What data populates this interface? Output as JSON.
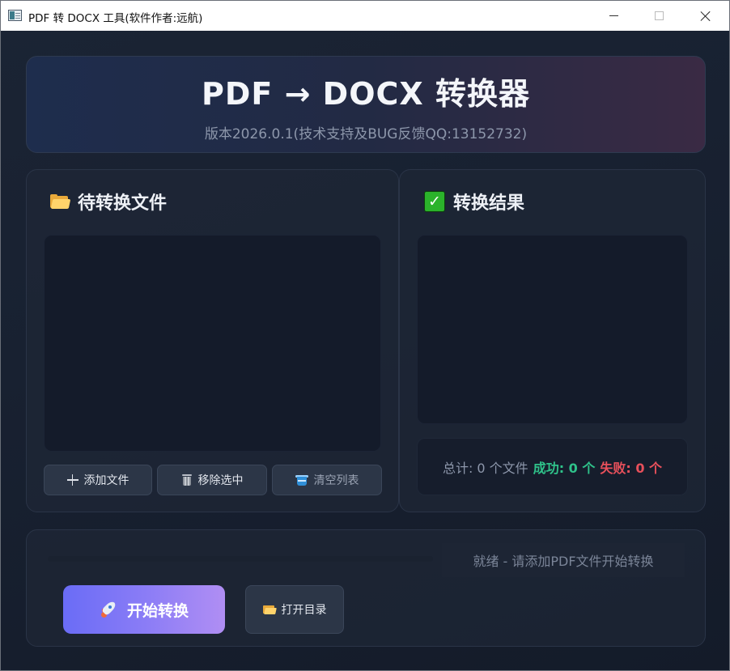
{
  "window": {
    "title": "PDF 转 DOCX 工具(软件作者:远航)"
  },
  "header": {
    "title": "PDF → DOCX 转换器",
    "version": "版本2026.0.1(技术支持及BUG反馈QQ:13152732)"
  },
  "pending_panel": {
    "heading": "待转换文件",
    "icon": "folder-icon",
    "files": [],
    "buttons": {
      "add": "添加文件",
      "remove": "移除选中",
      "clear": "清空列表"
    }
  },
  "results_panel": {
    "heading": "转换结果",
    "icon": "check-icon",
    "results": [],
    "summary": {
      "total": "总计: 0 个文件",
      "success": "成功: 0 个",
      "failed": "失败: 0 个"
    }
  },
  "bottom": {
    "progress": 0,
    "status": "就绪 - 请添加PDF文件开始转换",
    "start_label": "开始转换",
    "open_dir_label": "打开目录"
  },
  "colors": {
    "accent_start": "#6a6cf6",
    "accent_end": "#b08ef3",
    "success": "#2fc28a",
    "failure": "#e8505b",
    "background": "#182131"
  }
}
